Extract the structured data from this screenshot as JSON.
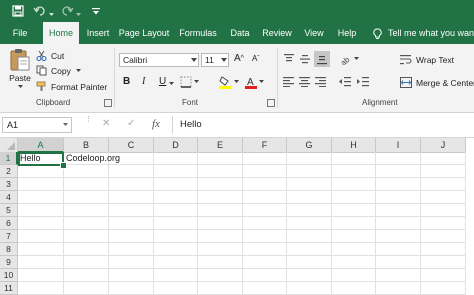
{
  "quick_access": {
    "save": "save-icon",
    "undo": "undo-icon",
    "redo": "redo-icon",
    "customize": "customize-icon"
  },
  "tabs": [
    "File",
    "Home",
    "Insert",
    "Page Layout",
    "Formulas",
    "Data",
    "Review",
    "View",
    "Help",
    "Tell me what you want"
  ],
  "active_tab": "Home",
  "ribbon": {
    "clipboard": {
      "paste": "Paste",
      "cut": "Cut",
      "copy": "Copy",
      "format_painter": "Format Painter",
      "label": "Clipboard"
    },
    "font": {
      "name": "Calibri",
      "size": "11",
      "grow": "A",
      "shrink": "A",
      "bold": "B",
      "italic": "I",
      "underline": "U",
      "label": "Font"
    },
    "alignment": {
      "wrap_text": "Wrap Text",
      "merge_center": "Merge & Center",
      "label": "Alignment"
    }
  },
  "formula_bar": {
    "name_box": "A1",
    "cancel": "✕",
    "enter": "✓",
    "fx": "fx",
    "content": "Hello"
  },
  "columns": [
    "A",
    "B",
    "C",
    "D",
    "E",
    "F",
    "G",
    "H",
    "I",
    "J"
  ],
  "rows": [
    "1",
    "2",
    "3",
    "4",
    "5",
    "6",
    "7",
    "8",
    "9",
    "10",
    "11"
  ],
  "cells": {
    "A1": "Hello",
    "B1": "Codeloop.org"
  },
  "colors": {
    "accent": "#217346",
    "header_bg": "#e6e6e6",
    "ribbon_bg": "#f3f3f3"
  }
}
